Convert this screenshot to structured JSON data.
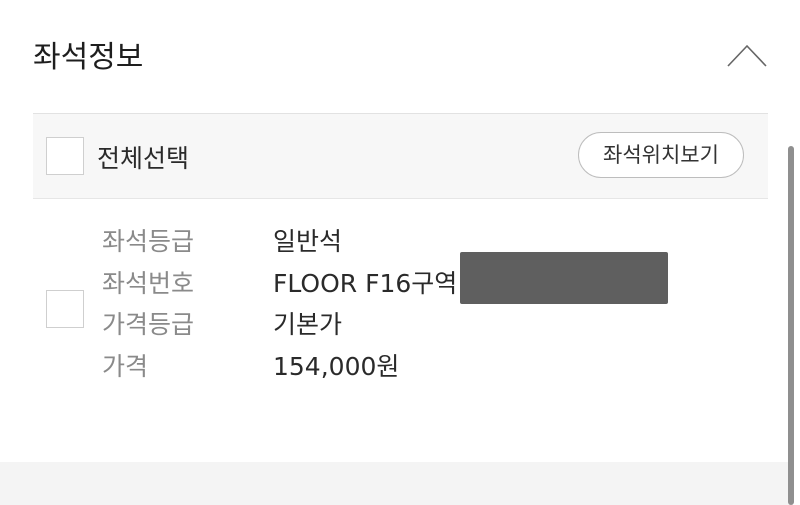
{
  "section": {
    "title": "좌석정보"
  },
  "select_all": {
    "label": "전체선택",
    "checked": false
  },
  "seat_map_button": {
    "label": "좌석위치보기"
  },
  "seat": {
    "checked": false,
    "rows": [
      {
        "label": "좌석등급",
        "value": "일반석"
      },
      {
        "label": "좌석번호",
        "value": "FLOOR F16구역"
      },
      {
        "label": "가격등급",
        "value": "기본가"
      },
      {
        "label": "가격",
        "value": "154,000원"
      }
    ]
  },
  "icons": {
    "collapse": "chevron-up-icon"
  },
  "colors": {
    "title_text": "#1e1e1e",
    "label_text": "#8a8a8a",
    "value_text": "#2a2a2a",
    "bar_background": "#f7f7f7",
    "redaction": "#5f5f5f"
  }
}
